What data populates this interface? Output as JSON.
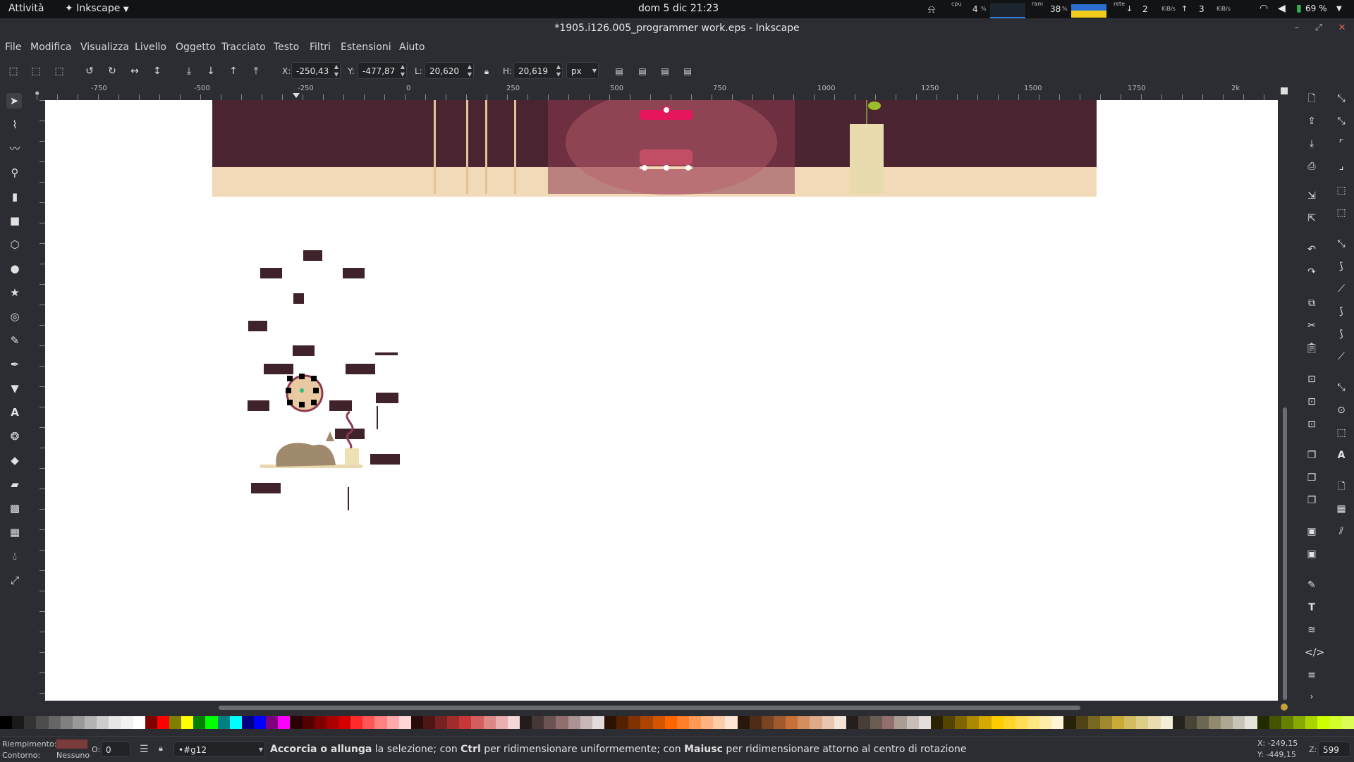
{
  "system_bar": {
    "activities": "Attività",
    "app_menu": "Inkscape",
    "clock": "dom 5 dic  21:23",
    "cpu_label": "cpu",
    "cpu_value": "4",
    "ram_label": "ram",
    "ram_value": "38",
    "net_label": "rete",
    "net_down": "2",
    "net_up": "3",
    "net_unit": "KiB/s",
    "battery": "69 %"
  },
  "window": {
    "title": "*1905.i126.005_programmer work.eps - Inkscape"
  },
  "menu": [
    "File",
    "Modifica",
    "Visualizza",
    "Livello",
    "Oggetto",
    "Tracciato",
    "Testo",
    "Filtri",
    "Estensioni",
    "Aiuto"
  ],
  "controls": {
    "x_label": "X:",
    "x_value": "-250,43",
    "y_label": "Y:",
    "y_value": "-477,87",
    "w_label": "L:",
    "w_value": "20,620",
    "h_label": "H:",
    "h_value": "20,619",
    "unit": "px"
  },
  "ruler_labels": [
    "-750",
    "-500",
    "-250",
    "0",
    "250",
    "500",
    "750",
    "1000",
    "1250",
    "1500",
    "1750",
    "2k"
  ],
  "statusbar": {
    "fill_label": "Riempimento:",
    "stroke_label": "Contorno:",
    "stroke_value": "Nessuno",
    "opacity_label": "O:",
    "opacity_value": "0",
    "layer": "•#g12",
    "msg_b1": "Accorcia o allunga",
    "msg_1": " la selezione; con ",
    "msg_b2": "Ctrl",
    "msg_2": " per ridimensionare uniformemente; con ",
    "msg_b3": "Maiusc",
    "msg_3": " per ridimensionare attorno al centro di rotazione",
    "cursor_x": "X: -249,15",
    "cursor_y": "Y: -449,15",
    "zoom_label": "Z:",
    "zoom_value": "599"
  },
  "colors": {
    "fill_swatch": "#7a3b3b",
    "wall": "#4a2430",
    "floor": "#f2d9b8",
    "brick": "#40222a"
  }
}
